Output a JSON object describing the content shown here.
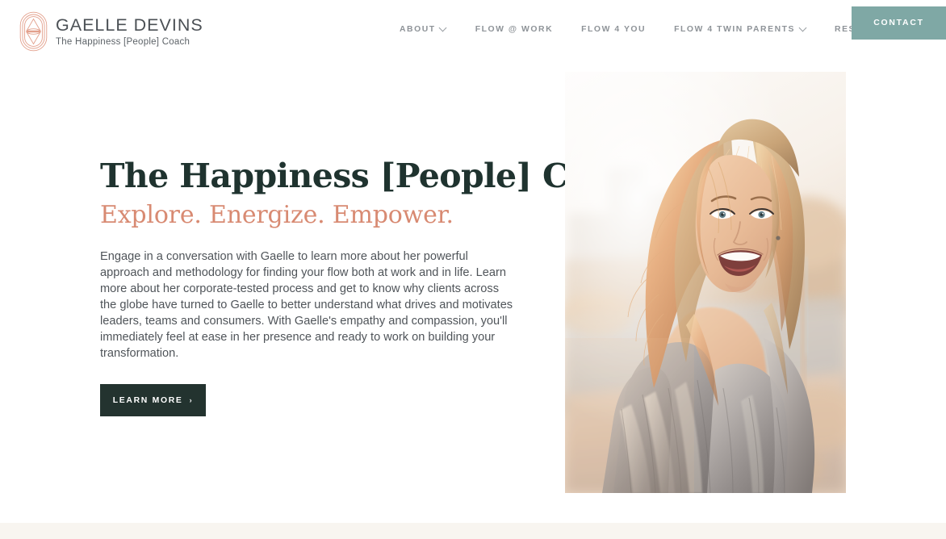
{
  "brand": {
    "name": "GAELLE DEVINS",
    "tagline": "The Happiness [People] Coach",
    "logo_icon": "oval-monogram-icon",
    "logo_color": "#e3a08c"
  },
  "nav": {
    "items": [
      {
        "label": "ABOUT",
        "has_dropdown": true
      },
      {
        "label": "FLOW @ WORK",
        "has_dropdown": false
      },
      {
        "label": "FLOW 4 YOU",
        "has_dropdown": false
      },
      {
        "label": "FLOW 4 TWIN PARENTS",
        "has_dropdown": true
      },
      {
        "label": "RESOURCES",
        "has_dropdown": true
      }
    ],
    "contact_label": "CONTACT",
    "contact_color": "#7fa8a5",
    "link_color": "#8e9398"
  },
  "hero": {
    "title": "The Happiness [People] Coach",
    "title_color": "#1f332f",
    "subtitle": "Explore. Energize. Empower.",
    "subtitle_color": "#d88a72",
    "paragraph": "Engage in a conversation with Gaelle to learn more about her powerful approach and methodology for finding your flow both at work and in life. Learn more about her corporate-tested process and get to know why clients across the globe have turned to Gaelle to better understand what drives and motivates leaders, teams and consumers. With Gaelle's empathy and compassion, you'll immediately feel at ease in her presence and ready to work on building your transformation.",
    "cta_label": "LEARN MORE",
    "cta_arrow": "›",
    "cta_color": "#23332f",
    "photo_alt": "Smiling blonde woman in gray fur coat outdoors at golden hour"
  },
  "footer": {
    "band_color": "#f8f5f0"
  }
}
